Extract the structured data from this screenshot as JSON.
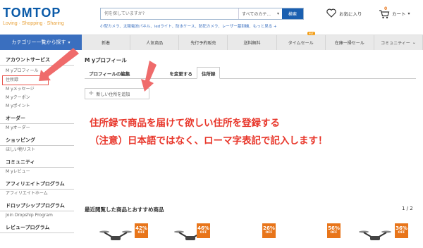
{
  "header": {
    "logo": "TOMTOP",
    "tagline": "Loving · Shopping · Sharing",
    "search_placeholder": "何を探していますか?",
    "search_category": "すべてのカテ...",
    "search_button": "検索",
    "hot_words": "小型カメラ、太陽電池パネル、ledライト、防水ケース、防犯カメラ、レーザー墓刻機、もっと見る +",
    "favorites": "お気に入り",
    "cart": "カート",
    "cart_count": "0"
  },
  "nav": {
    "category_button": "カテゴリー一覧から探す",
    "items": [
      {
        "label": "新着"
      },
      {
        "label": "人気商品"
      },
      {
        "label": "先行予約販売"
      },
      {
        "label": "送料無料"
      },
      {
        "label": "タイムセール",
        "badge": "Hot"
      },
      {
        "label": "在庫一掃セール"
      },
      {
        "label": "コミュニティー"
      }
    ]
  },
  "sidebar": [
    {
      "title": "アカウントサービス",
      "items": [
        "M yプロフィール",
        "住所録",
        "M yメッセージ",
        "M yクーポン",
        "M yポイント"
      ]
    },
    {
      "title": "オーダー",
      "items": [
        "M yオーダー"
      ]
    },
    {
      "title": "ショッピング",
      "items": [
        "ほしい物リスト"
      ]
    },
    {
      "title": "コミュニティ",
      "items": [
        "M yレビュー"
      ]
    },
    {
      "title": "アフィリエイトプログラム",
      "items": [
        "アフィリエイトホーム"
      ]
    },
    {
      "title": "ドロップシッププログラム",
      "items": [
        "Join Dropship Program"
      ]
    },
    {
      "title": "レビュープログラム",
      "items": []
    }
  ],
  "main": {
    "title": "M yプロフィール",
    "tabs": [
      "プロフィールの編集",
      "を変更する",
      "住所録"
    ],
    "add_address": "新しい住所を追加",
    "note_line1": "住所録で商品を届けて欲しい住所を登録する",
    "note_line2": "（注意）日本語ではなく、ローマ字表記で記入します！"
  },
  "recommend": {
    "title": "最近閲覧した商品とおすすめ商品",
    "page": "1 / 2",
    "off_label": "OFF",
    "badges": [
      "42%",
      "46%",
      "26%",
      "56%",
      "36%"
    ]
  },
  "colors": {
    "brand": "#0a5aa8",
    "nav": "#3a6fbf",
    "annotation": "#e8362a",
    "badge": "#e8751a"
  }
}
